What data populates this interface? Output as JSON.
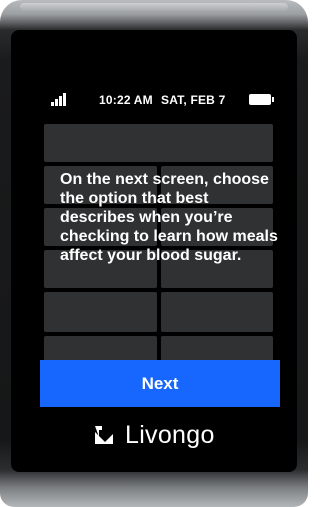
{
  "status_bar": {
    "signal_icon": "cellular-signal-icon",
    "time": "10:22 AM",
    "date": "SAT, FEB 7",
    "battery_icon": "battery-full-icon"
  },
  "message": {
    "text": "On the next screen, choose the option that best describes when you’re checking to learn how meals affect your blood sugar."
  },
  "actions": {
    "next_label": "Next"
  },
  "brand": {
    "logo_icon": "livongo-logo-icon",
    "name": "Livongo"
  },
  "colors": {
    "accent": "#1767ff",
    "screen_bg": "#000000",
    "tile": "#2f3133",
    "text": "#ffffff"
  }
}
